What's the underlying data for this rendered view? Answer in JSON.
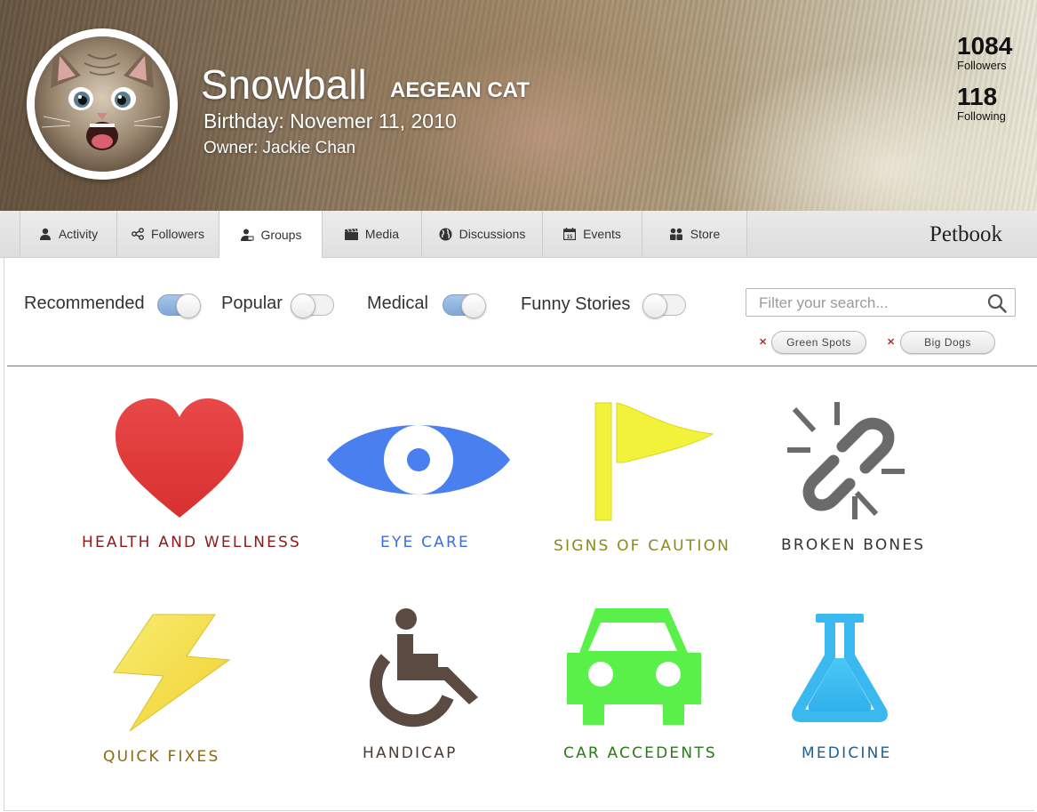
{
  "profile": {
    "name": "Snowball",
    "breed": "AEGEAN CAT",
    "birthday": "Birthday: Novemer 11, 2010",
    "owner": "Owner: Jackie Chan",
    "followers_count": "1084",
    "followers_label": "Followers",
    "following_count": "118",
    "following_label": "Following"
  },
  "tabs": [
    {
      "label": "Activity",
      "icon": "person-icon"
    },
    {
      "label": "Followers",
      "icon": "share-icon"
    },
    {
      "label": "Groups",
      "icon": "group-icon",
      "active": true
    },
    {
      "label": "Media",
      "icon": "clapperboard-icon"
    },
    {
      "label": "Discussions",
      "icon": "globe-icon"
    },
    {
      "label": "Events",
      "icon": "calendar-icon"
    },
    {
      "label": "Store",
      "icon": "users-icon"
    }
  ],
  "brand": "Petbook",
  "filters": [
    {
      "label": "Recommended",
      "on": true
    },
    {
      "label": "Popular",
      "on": false
    },
    {
      "label": "Medical",
      "on": true
    },
    {
      "label": "Funny Stories",
      "on": false
    }
  ],
  "search": {
    "placeholder": "Filter your search...",
    "value": ""
  },
  "tags": [
    {
      "label": "Green Spots"
    },
    {
      "label": "Big Dogs"
    }
  ],
  "categories": [
    {
      "label": "HEALTH AND WELLNESS",
      "icon": "heart-icon",
      "color": "#8b1a1a"
    },
    {
      "label": "EYE CARE",
      "icon": "eye-icon",
      "color": "#3a6fd8"
    },
    {
      "label": "SIGNS OF CAUTION",
      "icon": "flag-icon",
      "color": "#8a8a1a"
    },
    {
      "label": "BROKEN BONES",
      "icon": "broken-link-icon",
      "color": "#333333"
    },
    {
      "label": "QUICK FIXES",
      "icon": "lightning-icon",
      "color": "#8a6a10"
    },
    {
      "label": "HANDICAP",
      "icon": "wheelchair-icon",
      "color": "#4a3a32"
    },
    {
      "label": "CAR ACCEDENTS",
      "icon": "car-icon",
      "color": "#2a7a1a"
    },
    {
      "label": "MEDICINE",
      "icon": "flask-icon",
      "color": "#1f5f8f"
    }
  ],
  "colors": {
    "toggle_on": "#7ea7d8",
    "heart": "#e04040",
    "eye": "#4a7ff0",
    "flag": "#f2f23a",
    "broken_link": "#6a6a6a",
    "lightning": "#f5e04a",
    "wheelchair": "#5a4a42",
    "car": "#5af04a",
    "flask": "#3ab8f0"
  }
}
